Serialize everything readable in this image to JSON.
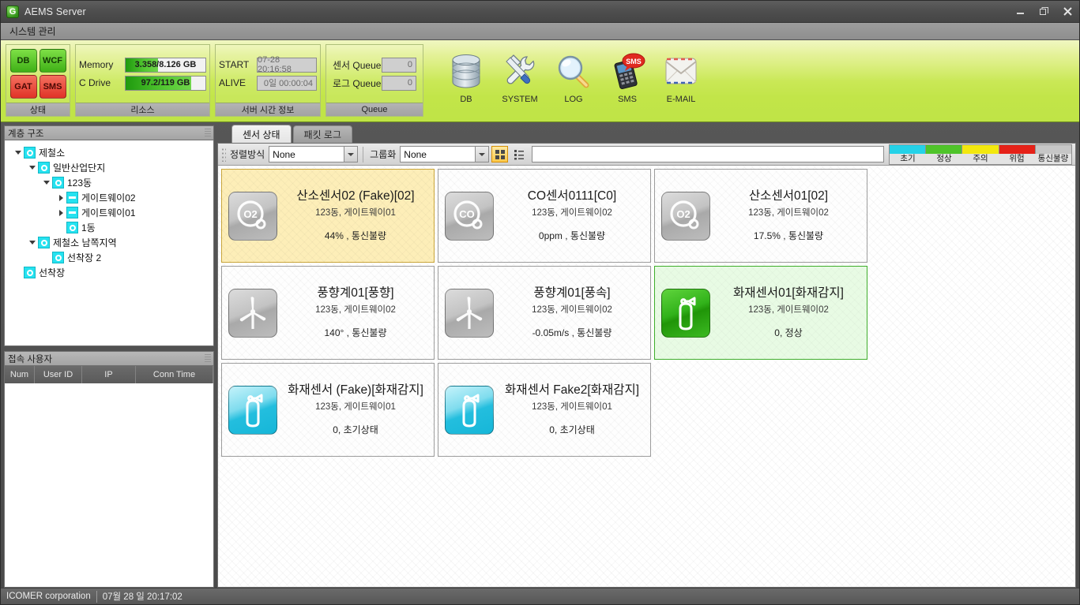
{
  "window": {
    "title": "AEMS Server",
    "logo_letter": "G",
    "controls": [
      {
        "name": "minimize-button",
        "label": "–"
      },
      {
        "name": "restore-button",
        "label": "❐"
      },
      {
        "name": "close-button",
        "label": "✕"
      }
    ]
  },
  "menubar": {
    "items": [
      {
        "label": "시스템 관리"
      }
    ]
  },
  "ribbon": {
    "status_group": {
      "caption": "상태",
      "items": [
        {
          "label": "DB",
          "state": "ok",
          "color": "#52c226"
        },
        {
          "label": "WCF",
          "state": "ok",
          "color": "#52c226"
        },
        {
          "label": "GAT",
          "state": "error",
          "color": "#e6392c"
        },
        {
          "label": "SMS",
          "state": "error",
          "color": "#e6392c"
        }
      ]
    },
    "resource_group": {
      "caption": "리소스",
      "rows": [
        {
          "label": "Memory",
          "value": "3.358/8.126 GB",
          "percent": 41
        },
        {
          "label": "C Drive",
          "value": "97.2/119 GB",
          "percent": 82
        }
      ]
    },
    "time_group": {
      "caption": "서버 시간 정보",
      "rows": [
        {
          "label": "START",
          "value": "07-28 20:16:58"
        },
        {
          "label": "ALIVE",
          "value": "0일 00:00:04"
        }
      ]
    },
    "queue_group": {
      "caption": "Queue",
      "rows": [
        {
          "label": "센서 Queue",
          "value": "0"
        },
        {
          "label": "로그 Queue",
          "value": "0"
        }
      ]
    },
    "buttons": [
      {
        "label": "DB",
        "icon": "database-icon"
      },
      {
        "label": "SYSTEM",
        "icon": "tools-icon"
      },
      {
        "label": "LOG",
        "icon": "magnifier-icon"
      },
      {
        "label": "SMS",
        "icon": "sms-phone-icon"
      },
      {
        "label": "E-MAIL",
        "icon": "envelope-icon"
      }
    ]
  },
  "tree_panel": {
    "header": "계층 구조",
    "nodes": [
      {
        "label": "제철소",
        "depth": 0,
        "toggle": "open",
        "icon": "circle"
      },
      {
        "label": "일반산업단지",
        "depth": 1,
        "toggle": "open",
        "icon": "circle"
      },
      {
        "label": "123동",
        "depth": 2,
        "toggle": "open",
        "icon": "circle"
      },
      {
        "label": "게이트웨이02",
        "depth": 3,
        "toggle": "closed",
        "icon": "gateway"
      },
      {
        "label": "게이트웨이01",
        "depth": 3,
        "toggle": "closed",
        "icon": "gateway"
      },
      {
        "label": "1동",
        "depth": 3,
        "toggle": "none",
        "icon": "circle"
      },
      {
        "label": "제철소 남쪽지역",
        "depth": 1,
        "toggle": "open",
        "icon": "circle"
      },
      {
        "label": "선착장 2",
        "depth": 2,
        "toggle": "none",
        "icon": "circle"
      },
      {
        "label": "선착장",
        "depth": 0,
        "toggle": "none",
        "icon": "circle"
      }
    ]
  },
  "users_panel": {
    "header": "접속 사용자",
    "columns": [
      {
        "label": "Num",
        "width": 38
      },
      {
        "label": "User ID",
        "width": 60
      },
      {
        "label": "IP",
        "width": 68
      },
      {
        "label": "Conn Time",
        "width": 98
      }
    ],
    "rows": []
  },
  "tabs": [
    {
      "label": "센서 상태",
      "active": true
    },
    {
      "label": "패킷 로그",
      "active": false
    }
  ],
  "filterbar": {
    "sort_label": "정렬방식",
    "sort_value": "None",
    "group_label": "그룹화",
    "group_value": "None",
    "search_value": "",
    "view_buttons": [
      {
        "name": "tile-view-button",
        "active": true
      },
      {
        "name": "list-view-button",
        "active": false
      }
    ]
  },
  "legend": [
    {
      "label": "초기",
      "color": "#25d2e8"
    },
    {
      "label": "정상",
      "color": "#4fc42a"
    },
    {
      "label": "주의",
      "color": "#f3e80e"
    },
    {
      "label": "위험",
      "color": "#e52118"
    },
    {
      "label": "통신불량",
      "color": "#c6c6c6"
    }
  ],
  "cards": [
    {
      "title": "산소센서02 (Fake)[02]",
      "location": "123동, 게이트웨이01",
      "reading": "44% , 통신불량",
      "icon": "oxygen-sensor-icon",
      "icon_text": "O2",
      "tone": "amber",
      "icon_tone": "gray"
    },
    {
      "title": "CO센서0111[C0]",
      "location": "123동, 게이트웨이02",
      "reading": "0ppm , 통신불량",
      "icon": "co-sensor-icon",
      "icon_text": "CO",
      "tone": "plain",
      "icon_tone": "gray"
    },
    {
      "title": "산소센서01[02]",
      "location": "123동, 게이트웨이02",
      "reading": "17.5% , 통신불량",
      "icon": "oxygen-sensor-icon",
      "icon_text": "O2",
      "tone": "plain",
      "icon_tone": "gray"
    },
    {
      "title": "풍향계01[풍향]",
      "location": "123동, 게이트웨이02",
      "reading": "140° , 통신불량",
      "icon": "wind-turbine-icon",
      "icon_text": "",
      "tone": "plain",
      "icon_tone": "gray"
    },
    {
      "title": "풍향계01[풍속]",
      "location": "123동, 게이트웨이02",
      "reading": "-0.05m/s , 통신불량",
      "icon": "wind-turbine-icon",
      "icon_text": "",
      "tone": "plain",
      "icon_tone": "gray"
    },
    {
      "title": "화재센서01[화재감지]",
      "location": "123동, 게이트웨이02",
      "reading": "0, 정상",
      "icon": "fire-extinguisher-icon",
      "icon_text": "",
      "tone": "green",
      "icon_tone": "green"
    },
    {
      "title": "화재센서 (Fake)[화재감지]",
      "location": "123동, 게이트웨이01",
      "reading": "0, 초기상태",
      "icon": "fire-extinguisher-icon",
      "icon_text": "",
      "tone": "plain",
      "icon_tone": "cyan"
    },
    {
      "title": "화재센서 Fake2[화재감지]",
      "location": "123동, 게이트웨이01",
      "reading": "0, 초기상태",
      "icon": "fire-extinguisher-icon",
      "icon_text": "",
      "tone": "plain",
      "icon_tone": "cyan"
    }
  ],
  "statusbar": {
    "company": "ICOMER corporation",
    "datetime": "07월 28 일 20:17:02"
  }
}
